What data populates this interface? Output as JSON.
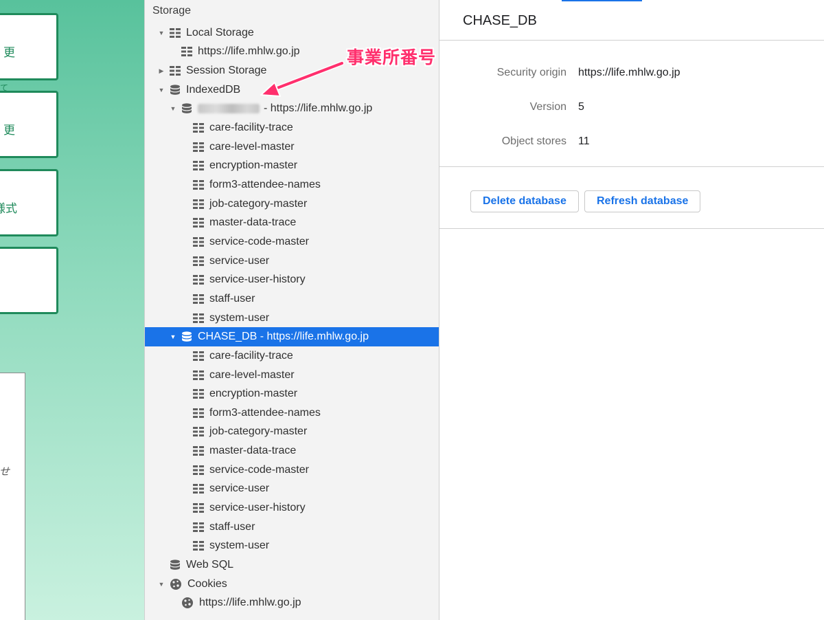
{
  "left_page": {
    "cards": [
      "更",
      "更",
      "様式",
      ""
    ],
    "card_fragment": "て",
    "side_text": "せ"
  },
  "sidebar": {
    "header": "Storage",
    "rows": [
      {
        "label": "Local Storage",
        "icon": "grid-icon",
        "twisty": "▼",
        "indent": 0
      },
      {
        "label": "https://life.mhlw.go.jp",
        "icon": "grid-icon",
        "twisty": "",
        "indent": 1
      },
      {
        "label": "Session Storage",
        "icon": "grid-icon",
        "twisty": "▶",
        "indent": 0
      },
      {
        "label": "IndexedDB",
        "icon": "database-icon",
        "twisty": "▼",
        "indent": 0
      },
      {
        "label": " - https://life.mhlw.go.jp",
        "icon": "database-icon",
        "twisty": "▼",
        "indent": 1,
        "blurred": true
      },
      {
        "label": "care-facility-trace",
        "icon": "grid-icon",
        "twisty": "",
        "indent": 2
      },
      {
        "label": "care-level-master",
        "icon": "grid-icon",
        "twisty": "",
        "indent": 2
      },
      {
        "label": "encryption-master",
        "icon": "grid-icon",
        "twisty": "",
        "indent": 2
      },
      {
        "label": "form3-attendee-names",
        "icon": "grid-icon",
        "twisty": "",
        "indent": 2
      },
      {
        "label": "job-category-master",
        "icon": "grid-icon",
        "twisty": "",
        "indent": 2
      },
      {
        "label": "master-data-trace",
        "icon": "grid-icon",
        "twisty": "",
        "indent": 2
      },
      {
        "label": "service-code-master",
        "icon": "grid-icon",
        "twisty": "",
        "indent": 2
      },
      {
        "label": "service-user",
        "icon": "grid-icon",
        "twisty": "",
        "indent": 2
      },
      {
        "label": "service-user-history",
        "icon": "grid-icon",
        "twisty": "",
        "indent": 2
      },
      {
        "label": "staff-user",
        "icon": "grid-icon",
        "twisty": "",
        "indent": 2
      },
      {
        "label": "system-user",
        "icon": "grid-icon",
        "twisty": "",
        "indent": 2
      },
      {
        "label": "CHASE_DB - https://life.mhlw.go.jp",
        "icon": "database-icon",
        "twisty": "▼",
        "indent": 1,
        "selected": true
      },
      {
        "label": "care-facility-trace",
        "icon": "grid-icon",
        "twisty": "",
        "indent": 2
      },
      {
        "label": "care-level-master",
        "icon": "grid-icon",
        "twisty": "",
        "indent": 2
      },
      {
        "label": "encryption-master",
        "icon": "grid-icon",
        "twisty": "",
        "indent": 2
      },
      {
        "label": "form3-attendee-names",
        "icon": "grid-icon",
        "twisty": "",
        "indent": 2
      },
      {
        "label": "job-category-master",
        "icon": "grid-icon",
        "twisty": "",
        "indent": 2
      },
      {
        "label": "master-data-trace",
        "icon": "grid-icon",
        "twisty": "",
        "indent": 2
      },
      {
        "label": "service-code-master",
        "icon": "grid-icon",
        "twisty": "",
        "indent": 2
      },
      {
        "label": "service-user",
        "icon": "grid-icon",
        "twisty": "",
        "indent": 2
      },
      {
        "label": "service-user-history",
        "icon": "grid-icon",
        "twisty": "",
        "indent": 2
      },
      {
        "label": "staff-user",
        "icon": "grid-icon",
        "twisty": "",
        "indent": 2
      },
      {
        "label": "system-user",
        "icon": "grid-icon",
        "twisty": "",
        "indent": 2
      },
      {
        "label": "Web SQL",
        "icon": "database-icon",
        "twisty": "",
        "indent": 0
      },
      {
        "label": "Cookies",
        "icon": "cookie-icon",
        "twisty": "▼",
        "indent": 0
      },
      {
        "label": "https://life.mhlw.go.jp",
        "icon": "cookie-icon",
        "twisty": "",
        "indent": 1
      }
    ]
  },
  "annotation": {
    "text": "事業所番号",
    "color": "#ff2f6d"
  },
  "detail": {
    "title": "CHASE_DB",
    "security_origin_label": "Security origin",
    "security_origin_value": "https://life.mhlw.go.jp",
    "version_label": "Version",
    "version_value": "5",
    "object_stores_label": "Object stores",
    "object_stores_value": "11",
    "delete_button": "Delete database",
    "refresh_button": "Refresh database"
  },
  "colors": {
    "selection": "#1a73e8",
    "accent": "#1a73e8",
    "page_green": "#1f8a5b"
  }
}
